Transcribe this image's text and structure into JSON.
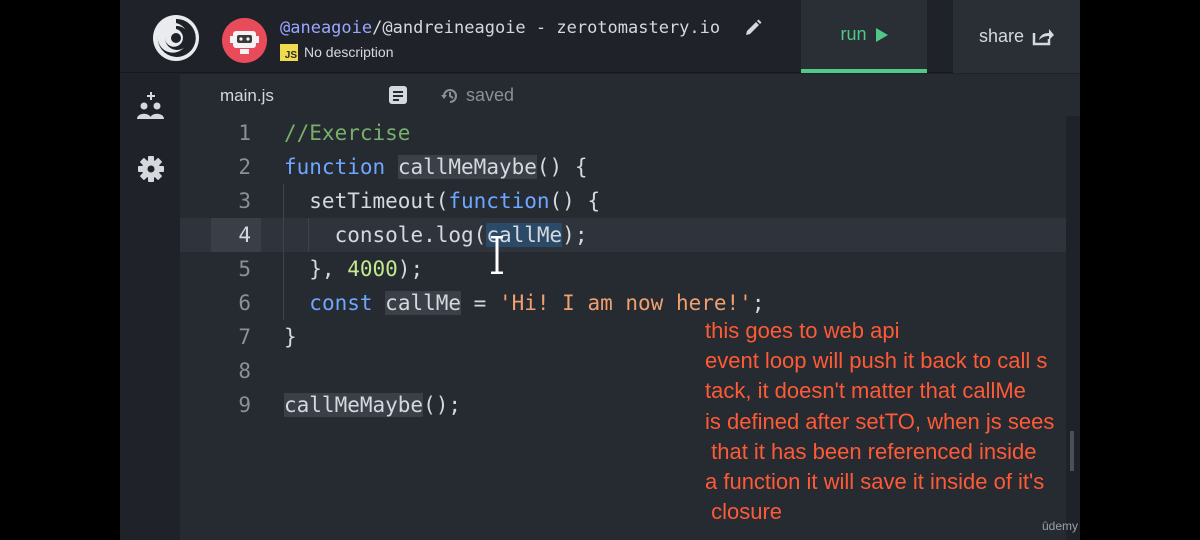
{
  "header": {
    "user": "@aneagoie",
    "repl_name": "@andreineagoie - zerotomastery.io",
    "description": "No description",
    "lang_badge": "JS",
    "run_label": "run",
    "share_label": "share"
  },
  "editor": {
    "tab_name": "main.js",
    "status": "saved",
    "active_line": 4,
    "lines": [
      {
        "n": "1",
        "text": "//Exercise"
      },
      {
        "n": "2",
        "text": "function callMeMaybe() {"
      },
      {
        "n": "3",
        "text": "  setTimeout(function() {"
      },
      {
        "n": "4",
        "text": "    console.log(callMe);"
      },
      {
        "n": "5",
        "text": "  }, 4000);"
      },
      {
        "n": "6",
        "text": "  const callMe = 'Hi! I am now here!';"
      },
      {
        "n": "7",
        "text": "}"
      },
      {
        "n": "8",
        "text": ""
      },
      {
        "n": "9",
        "text": "callMeMaybe();"
      }
    ]
  },
  "annotation": {
    "lines": [
      "this goes to web api",
      "event loop will push it back to call s",
      "tack, it doesn't matter that callMe",
      "is defined after setTO, when js sees",
      " that it has been referenced inside",
      "a function it will save it inside of it's",
      " closure"
    ],
    "color": "#ff5a36"
  },
  "watermark": "ûdemy",
  "icons": [
    "replit-logo-icon",
    "avatar-icon",
    "pencil-icon",
    "play-icon",
    "share-icon",
    "add-users-icon",
    "gear-icon",
    "document-icon",
    "history-icon",
    "text-cursor-icon"
  ]
}
